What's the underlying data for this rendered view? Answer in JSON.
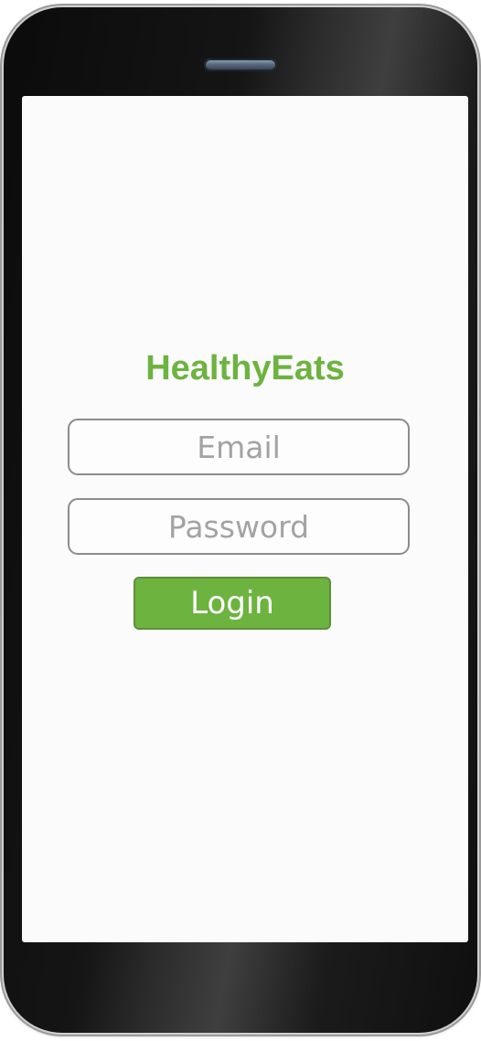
{
  "app": {
    "title": "HealthyEats"
  },
  "login_form": {
    "email_placeholder": "Email",
    "password_placeholder": "Password",
    "login_label": "Login"
  },
  "colors": {
    "brand_green": "#6db33f",
    "field_border": "#8c8c8c",
    "placeholder_text": "#a3a3a3",
    "screen_background": "#fbfbfb",
    "device_body": "#111111"
  }
}
